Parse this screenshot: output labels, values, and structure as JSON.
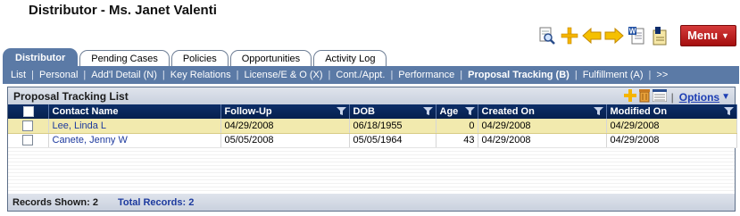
{
  "page": {
    "title": "Distributor - Ms. Janet Valenti"
  },
  "toolbar": {
    "icons": [
      "search-document-icon",
      "add-icon",
      "back-arrow-icon",
      "forward-arrow-icon",
      "word-document-icon",
      "pdf-document-icon"
    ],
    "menu_label": "Menu",
    "menu_color": "#c01f1f"
  },
  "tabs": [
    {
      "label": "Distributor",
      "active": true
    },
    {
      "label": "Pending Cases",
      "active": false
    },
    {
      "label": "Policies",
      "active": false
    },
    {
      "label": "Opportunities",
      "active": false
    },
    {
      "label": "Activity Log",
      "active": false
    }
  ],
  "subnav": [
    {
      "label": "List"
    },
    {
      "label": "Personal"
    },
    {
      "label": "Add'l Detail (N)"
    },
    {
      "label": "Key Relations"
    },
    {
      "label": "License/E & O (X)"
    },
    {
      "label": "Cont./Appt."
    },
    {
      "label": "Performance"
    },
    {
      "label": "Proposal Tracking (B)",
      "current": true
    },
    {
      "label": "Fulfillment (A)"
    },
    {
      "label": ">>"
    }
  ],
  "panel": {
    "title": "Proposal Tracking List",
    "separator": "|",
    "options_label": "Options",
    "columns": [
      "Contact Name",
      "Follow-Up",
      "DOB",
      "Age",
      "Created On",
      "Modified On"
    ],
    "rows": [
      {
        "contact": "Lee, Linda L",
        "followup": "04/29/2008",
        "dob": "06/18/1955",
        "age": "0",
        "created": "04/29/2008",
        "modified": "04/29/2008",
        "selected": true
      },
      {
        "contact": "Canete, Jenny W",
        "followup": "05/05/2008",
        "dob": "05/05/1964",
        "age": "43",
        "created": "04/29/2008",
        "modified": "04/29/2008",
        "selected": false
      }
    ],
    "records_shown": "Records Shown: 2",
    "total_records": "Total Records: 2"
  },
  "colors": {
    "accent": "#5b7aa6",
    "header_bg": "#0d2e68",
    "selected_row": "#f2eaae"
  }
}
